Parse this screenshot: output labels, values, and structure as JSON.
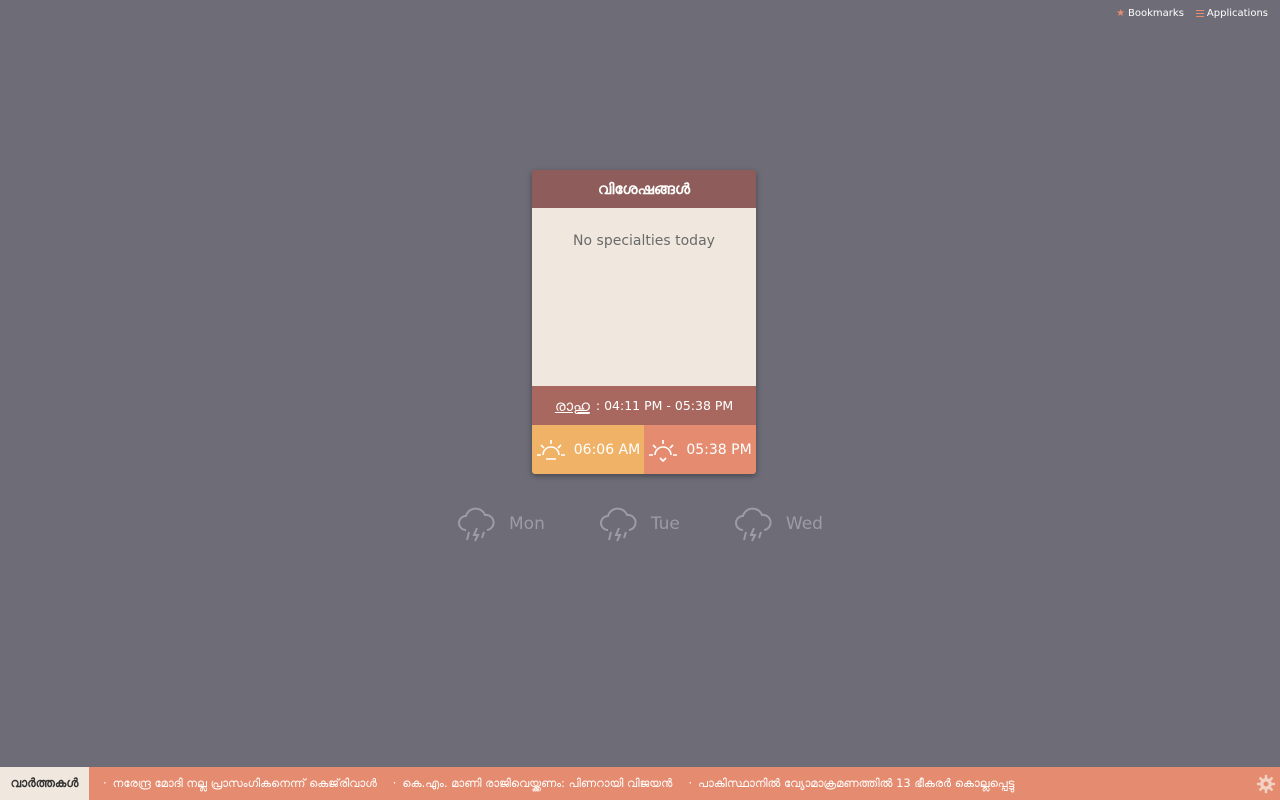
{
  "topbar": {
    "bookmarks": "Bookmarks",
    "applications": "Applications"
  },
  "card": {
    "title": "വിശേഷങ്ങൾ",
    "message": "No specialties today",
    "rahu_label": "രാഹു",
    "rahu_time": ": 04:11 PM - 05:38 PM",
    "sunrise": "06:06 AM",
    "sunset": "05:38 PM"
  },
  "forecast": [
    {
      "day": "Mon",
      "icon": "storm-icon"
    },
    {
      "day": "Tue",
      "icon": "storm-icon"
    },
    {
      "day": "Wed",
      "icon": "storm-icon"
    }
  ],
  "ticker": {
    "label": "വാർത്തകൾ",
    "items": [
      "നരേന്ദ്ര മോദി നല്ല പ്രാസംഗികനെന്ന് കെജ്‌രിവാൾ",
      "കെ.എം. മാണി രാജിവെയ്ക്കണം: പിണറായി വിജയൻ",
      "പാകിസ്ഥാനിൽ വ്യോമാക്രമണത്തിൽ 13 ഭീകരർ കൊല്ലപ്പെട്ടു"
    ]
  },
  "colors": {
    "background": "#6d6c77",
    "header": "#8e5d5b",
    "rahu": "#a8685f",
    "sunrise": "#f0b266",
    "sunset": "#e58c70",
    "accent": "#e58c70"
  }
}
